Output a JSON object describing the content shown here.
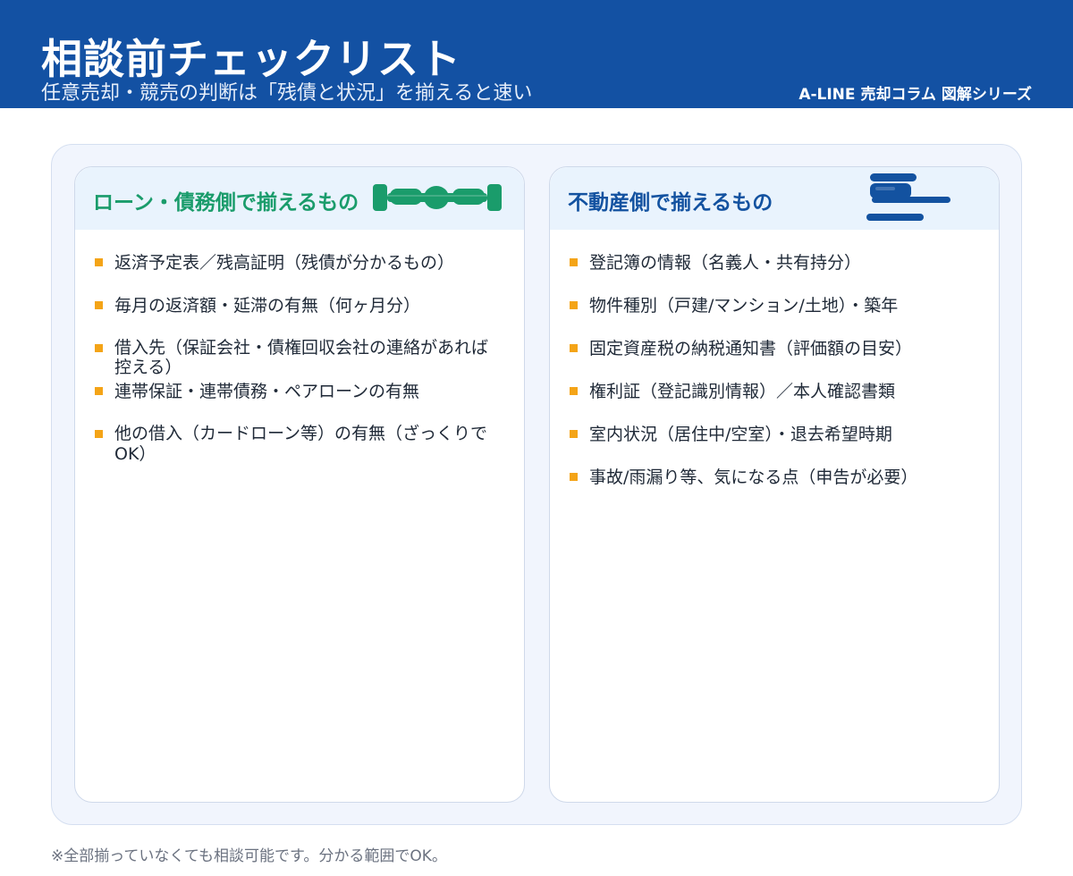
{
  "header": {
    "title": "相談前チェックリスト",
    "subtitle": "任意売却・競売の判断は「残債と状況」を揃えると速い",
    "series_label": "A-LINE 売却コラム 図解シリーズ",
    "background_color": "#1351a3"
  },
  "left_panel": {
    "title": "ローン・債務側で揃えるもの",
    "accent_color": "#1a9c6b",
    "items": [
      "返済予定表／残高証明（残債が分かるもの）",
      "毎月の返済額・延滞の有無（何ヶ月分）",
      "借入先（保証会社・債権回収会社の連絡があれば控える）",
      "連帯保証・連帯債務・ペアローンの有無",
      "他の借入（カードローン等）の有無（ざっくりでOK）"
    ]
  },
  "right_panel": {
    "title": "不動産側で揃えるもの",
    "accent_color": "#1352a0",
    "items": [
      "登記簿の情報（名義人・共有持分）",
      "物件種別（戸建/マンション/土地）・築年",
      "固定資産税の納税通知書（評価額の目安）",
      "権利証（登記識別情報）／本人確認書類",
      "室内状況（居住中/空室）・退去希望時期",
      "事故/雨漏り等、気になる点（申告が必要）"
    ]
  },
  "bullet_color": "#f4a417",
  "footnote": "※全部揃っていなくても相談可能です。分かる範囲でOK。"
}
